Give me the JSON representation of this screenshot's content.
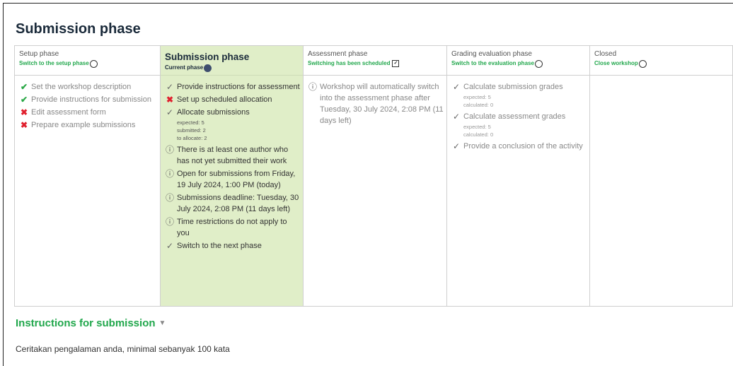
{
  "page_title": "Submission phase",
  "phases": [
    {
      "name": "Setup phase",
      "action": "Switch to the setup phase",
      "tasks": [
        {
          "status": "done",
          "text": "Set the workshop description"
        },
        {
          "status": "done",
          "text": "Provide instructions for submission"
        },
        {
          "status": "fail",
          "text": "Edit assessment form"
        },
        {
          "status": "fail",
          "text": "Prepare example submissions"
        }
      ]
    },
    {
      "name": "Submission phase",
      "action": "Current phase",
      "tasks": [
        {
          "status": "todo",
          "text": "Provide instructions for assessment"
        },
        {
          "status": "fail",
          "text": "Set up scheduled allocation"
        },
        {
          "status": "todo",
          "text": "Allocate submissions",
          "details": [
            "expected: 5",
            "submitted: 2",
            "to allocate: 2"
          ]
        },
        {
          "status": "info",
          "text": "There is at least one author who has not yet submitted their work"
        },
        {
          "status": "info",
          "text": "Open for submissions from Friday, 19 July 2024, 1:00 PM (today)"
        },
        {
          "status": "info",
          "text": "Submissions deadline: Tuesday, 30 July 2024, 2:08 PM (11 days left)"
        },
        {
          "status": "info",
          "text": "Time restrictions do not apply to you"
        },
        {
          "status": "todo",
          "text": "Switch to the next phase"
        }
      ]
    },
    {
      "name": "Assessment phase",
      "action": "Switching has been scheduled",
      "tasks": [
        {
          "status": "info",
          "text": "Workshop will automatically switch into the assessment phase after Tuesday, 30 July 2024, 2:08 PM (11 days left)"
        }
      ]
    },
    {
      "name": "Grading evaluation phase",
      "action": "Switch to the evaluation phase",
      "tasks": [
        {
          "status": "todo",
          "text": "Calculate submission grades",
          "details": [
            "expected: 5",
            "calculated: 0"
          ]
        },
        {
          "status": "todo",
          "text": "Calculate assessment grades",
          "details": [
            "expected: 5",
            "calculated: 0"
          ]
        },
        {
          "status": "todo",
          "text": "Provide a conclusion of the activity"
        }
      ]
    },
    {
      "name": "Closed",
      "action": "Close workshop",
      "tasks": []
    }
  ],
  "instructions": {
    "heading": "Instructions for submission",
    "text": "Ceritakan pengalaman anda, minimal sebanyak 100 kata"
  },
  "colors": {
    "green": "#21a74c",
    "current_bg": "#e0eec8",
    "fail": "#e0202e"
  }
}
